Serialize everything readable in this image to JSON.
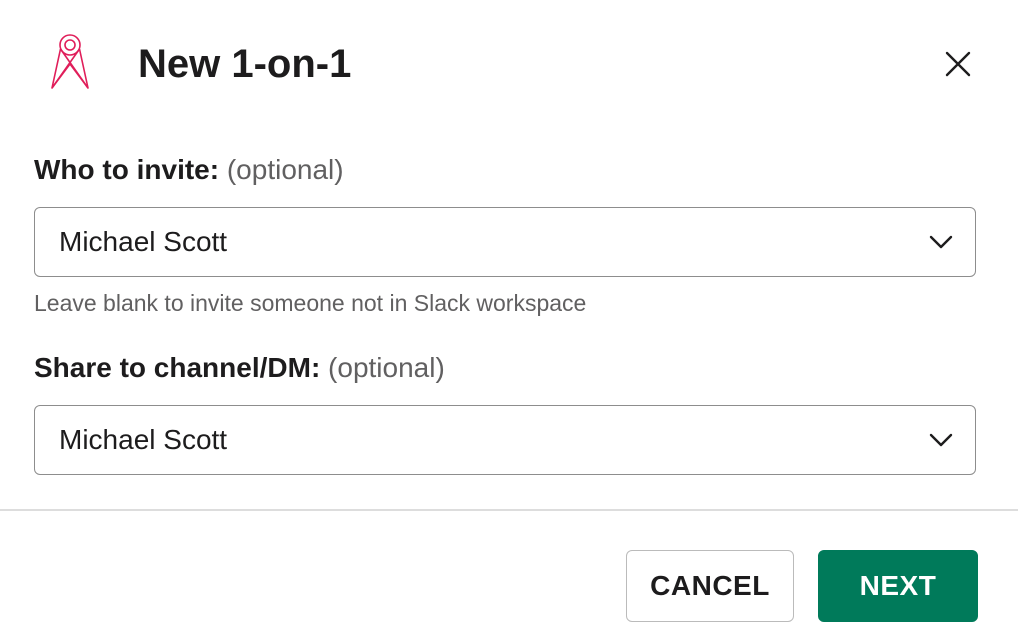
{
  "modal": {
    "title": "New 1-on-1",
    "app_icon": "map-pin-ribbon-icon",
    "close_icon": "close-icon"
  },
  "fields": {
    "invite": {
      "label": "Who to invite:",
      "optional": "(optional)",
      "value": "Michael Scott",
      "hint": "Leave blank to invite someone not in Slack workspace"
    },
    "share": {
      "label": "Share to channel/DM:",
      "optional": "(optional)",
      "value": "Michael Scott"
    }
  },
  "footer": {
    "cancel_label": "CANCEL",
    "next_label": "NEXT"
  },
  "colors": {
    "accent": "#007a5a",
    "icon_red": "#e01e5a",
    "text": "#1d1c1d",
    "muted": "#616061"
  }
}
